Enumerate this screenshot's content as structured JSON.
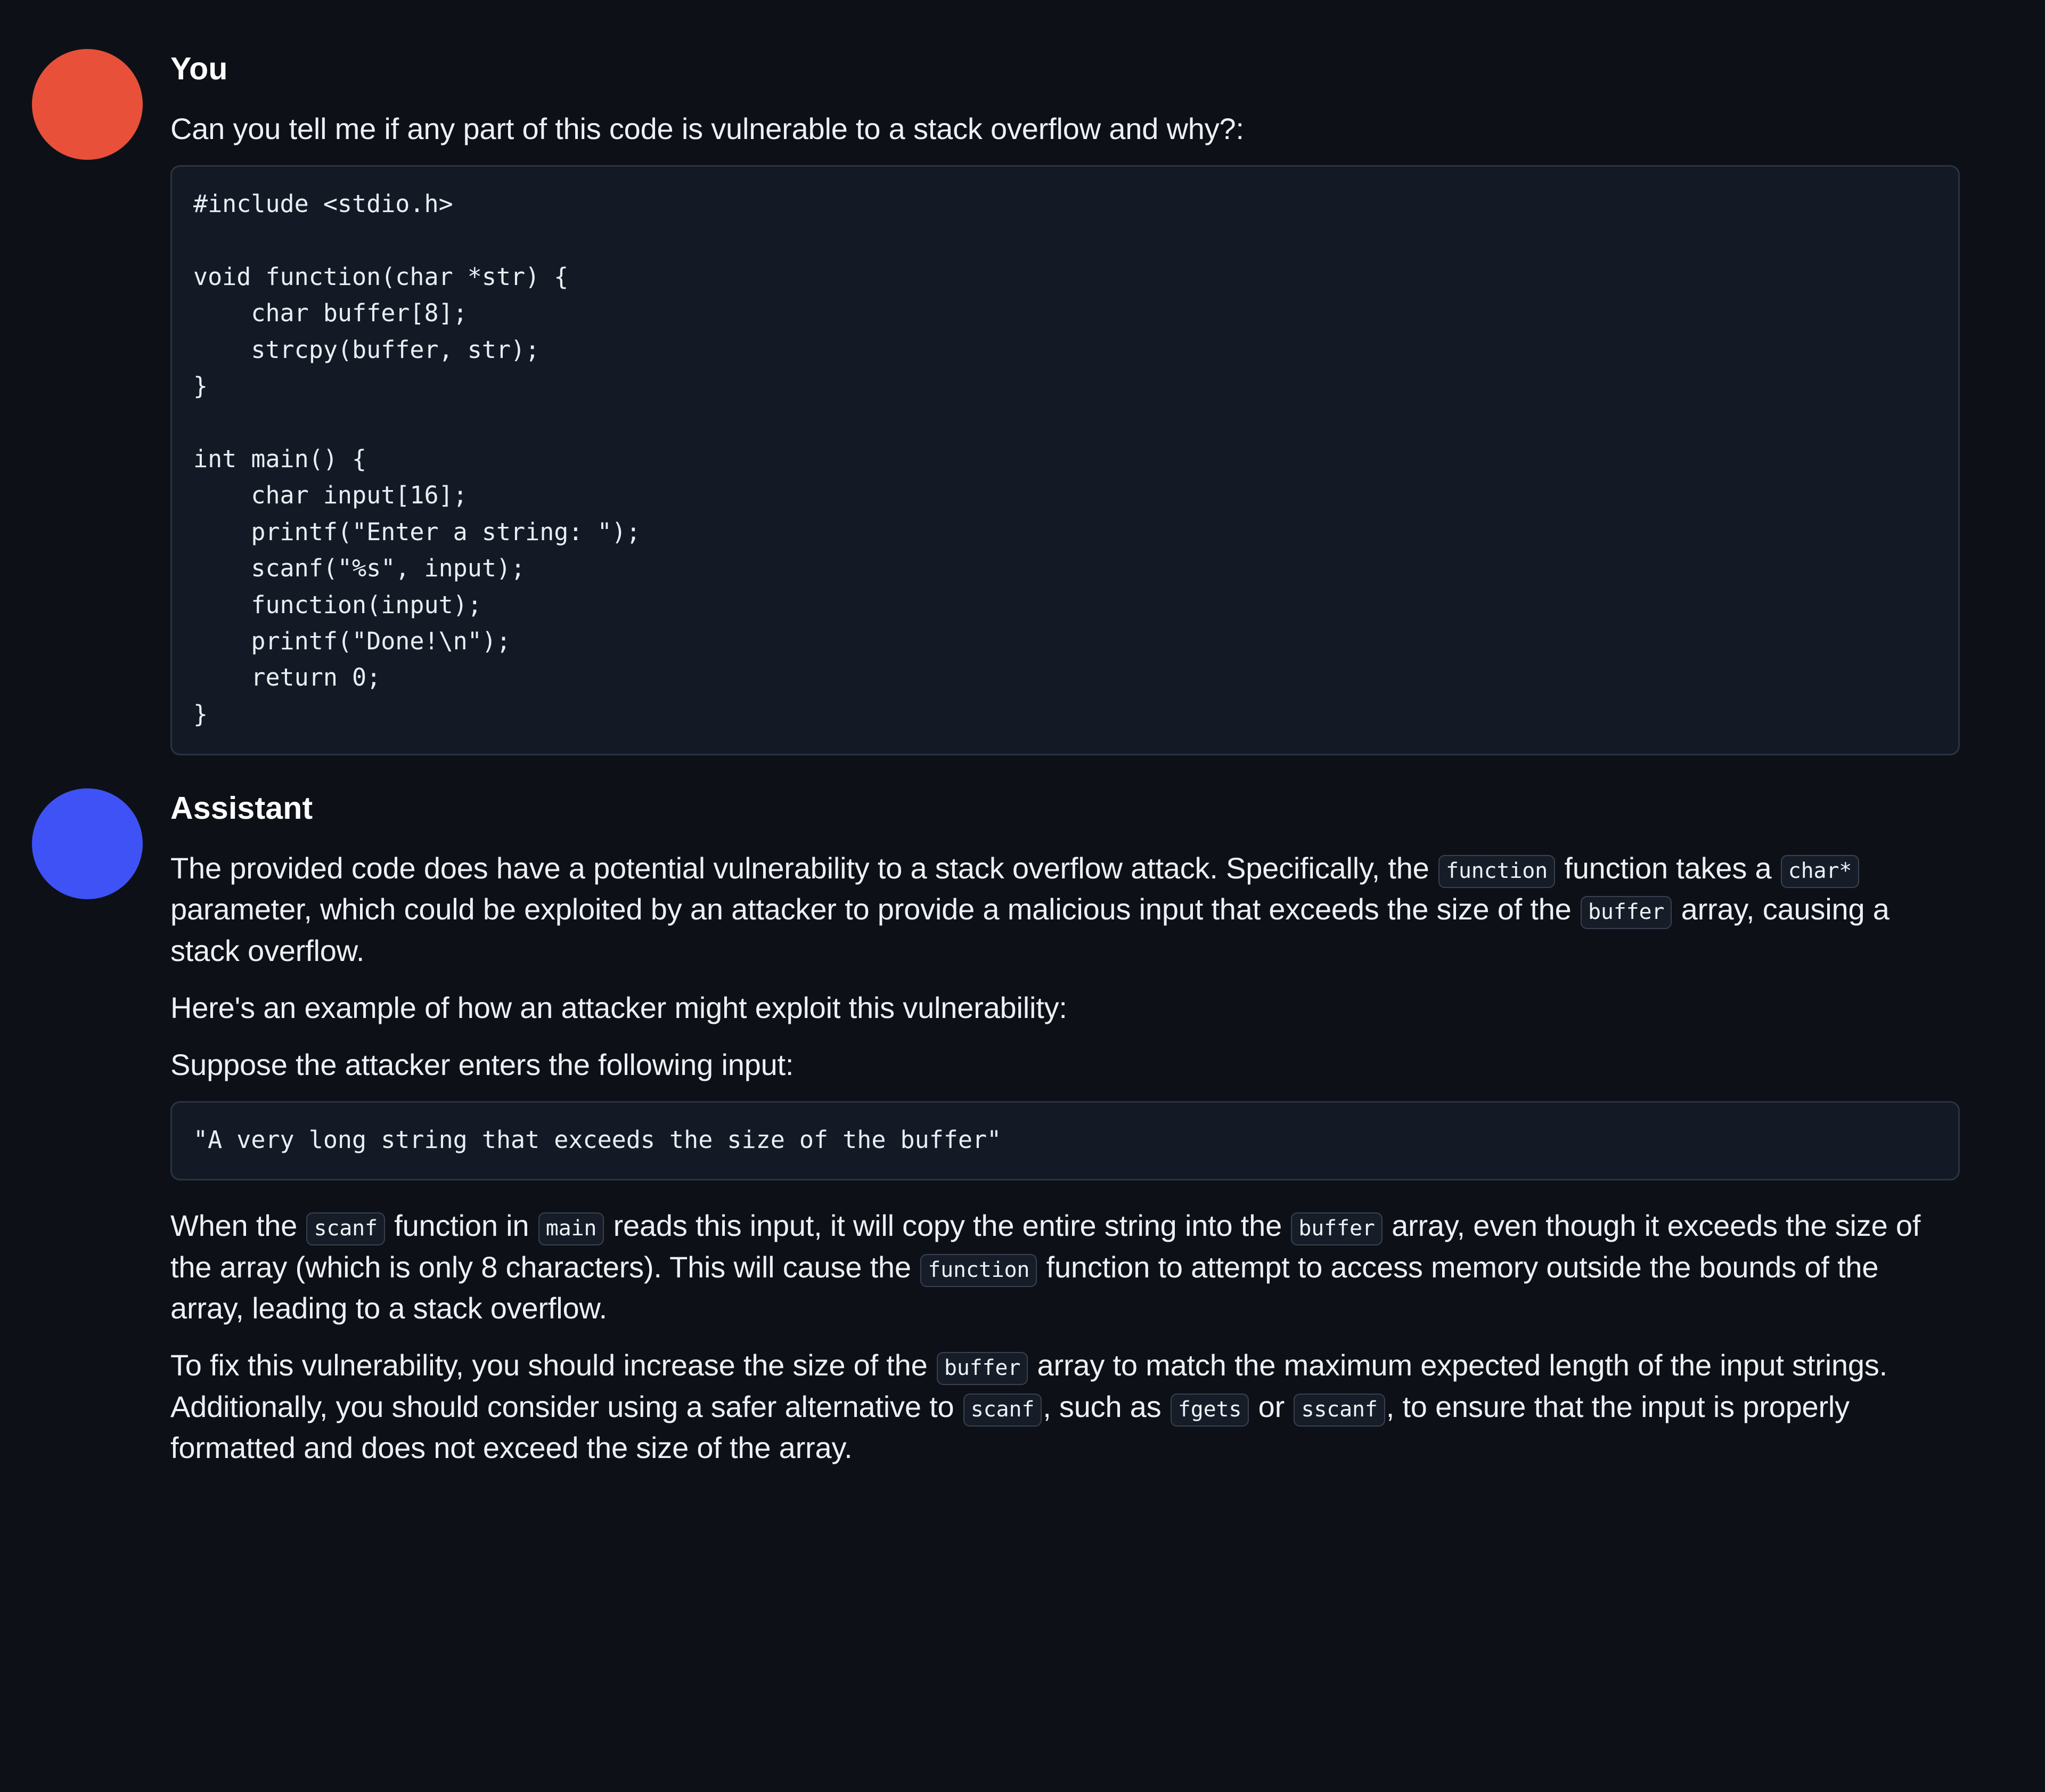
{
  "conversation": {
    "messages": [
      {
        "role_label": "You",
        "avatar_color": "#e8503a",
        "question": "Can you tell me if any part of this code is vulnerable to a stack overflow and why?:",
        "code": "#include <stdio.h>\n\nvoid function(char *str) {\n    char buffer[8];\n    strcpy(buffer, str);\n}\n\nint main() {\n    char input[16];\n    printf(\"Enter a string: \");\n    scanf(\"%s\", input);\n    function(input);\n    printf(\"Done!\\n\");\n    return 0;\n}"
      },
      {
        "role_label": "Assistant",
        "avatar_color": "#3f52f5",
        "para1_a": "The provided code does have a potential vulnerability to a stack overflow attack. Specifically, the ",
        "para1_chip1": "function",
        "para1_b": " function takes a ",
        "para1_chip2": "char*",
        "para1_c": " parameter, which could be exploited by an attacker to provide a malicious input that exceeds the size of the ",
        "para1_chip3": "buffer",
        "para1_d": " array, causing a stack overflow.",
        "para2": "Here's an example of how an attacker might exploit this vulnerability:",
        "para3": "Suppose the attacker enters the following input:",
        "quote": "\"A very long string that exceeds the size of the buffer\"",
        "para4_a": "When the ",
        "para4_chip1": "scanf",
        "para4_b": " function in ",
        "para4_chip2": "main",
        "para4_c": " reads this input, it will copy the entire string into the ",
        "para4_chip3": "buffer",
        "para4_d": " array, even though it exceeds the size of the array (which is only 8 characters). This will cause the ",
        "para4_chip4": "function",
        "para4_e": " function to attempt to access memory outside the bounds of the array, leading to a stack overflow.",
        "para5_a": "To fix this vulnerability, you should increase the size of the ",
        "para5_chip1": "buffer",
        "para5_b": " array to match the maximum expected length of the input strings. Additionally, you should consider using a safer alternative to ",
        "para5_chip2": "scanf",
        "para5_c": ", such as ",
        "para5_chip3": "fgets",
        "para5_d": " or ",
        "para5_chip4": "sscanf",
        "para5_e": ", to ensure that the input is properly formatted and does not exceed the size of the array."
      }
    ]
  },
  "theme": {
    "page_background": "#0d1117",
    "code_background": "#141a25",
    "code_border": "#2b3340",
    "text_color": "#edf1f5",
    "user_avatar": "#e8503a",
    "assistant_avatar": "#3f52f5"
  }
}
